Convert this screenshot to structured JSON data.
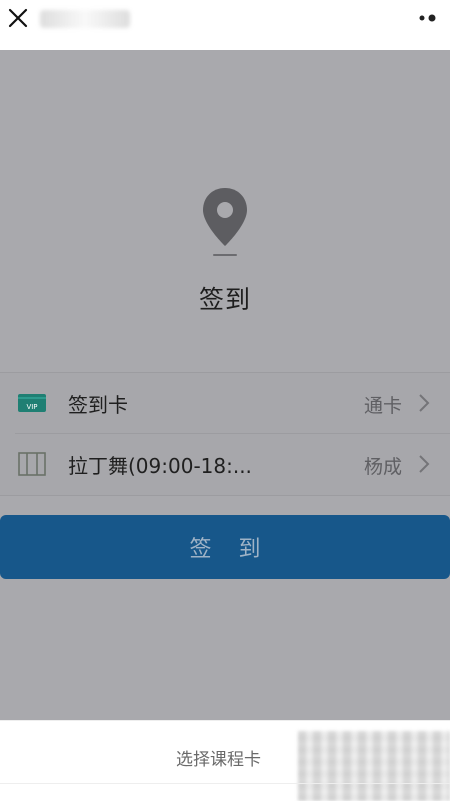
{
  "header": {
    "close_icon": "close-icon",
    "more_icon": "more-icon"
  },
  "checkin": {
    "pin_icon": "location-pin-icon",
    "title": "签到"
  },
  "list": {
    "rows": [
      {
        "icon": "vip-card-icon",
        "icon_text": "VIP",
        "label": "签到卡",
        "value": "通卡"
      },
      {
        "icon": "book-icon",
        "label": "拉丁舞(09:00-18:...",
        "value": "杨成"
      }
    ]
  },
  "submit": {
    "label": "签 到"
  },
  "bottom_sheet": {
    "label": "选择课程卡"
  },
  "colors": {
    "overlay_bg": "#a9a9ad",
    "button_bg": "#17578a",
    "button_text": "#9fb3c6",
    "vip_green": "#1f7f73"
  }
}
